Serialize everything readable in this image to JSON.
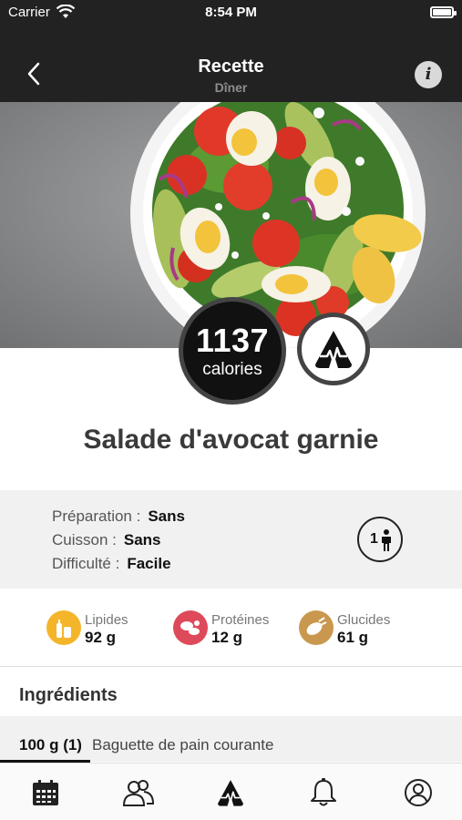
{
  "status_bar": {
    "carrier": "Carrier",
    "time": "8:54 PM"
  },
  "nav": {
    "title": "Recette",
    "subtitle": "Dîner",
    "info_label": "i"
  },
  "calories": {
    "value": "1137",
    "unit": "calories"
  },
  "recipe": {
    "title": "Salade d'avocat garnie"
  },
  "details": {
    "preparation_label": "Préparation :",
    "preparation_value": "Sans",
    "cuisson_label": "Cuisson :",
    "cuisson_value": "Sans",
    "difficulte_label": "Difficulté :",
    "difficulte_value": "Facile",
    "servings": "1"
  },
  "macros": [
    {
      "label": "Lipides",
      "value": "92 g",
      "color": "#f4b52a"
    },
    {
      "label": "Protéines",
      "value": "12 g",
      "color": "#de4a5a"
    },
    {
      "label": "Glucides",
      "value": "61 g",
      "color": "#c9984e"
    }
  ],
  "ingredients": {
    "heading": "Ingrédients",
    "items": [
      {
        "quantity": "100 g (1)",
        "name": "Baguette de pain courante"
      }
    ]
  },
  "tabs": [
    {
      "icon": "calendar-icon"
    },
    {
      "icon": "community-icon"
    },
    {
      "icon": "app-logo-icon"
    },
    {
      "icon": "bell-icon"
    },
    {
      "icon": "profile-icon"
    }
  ]
}
